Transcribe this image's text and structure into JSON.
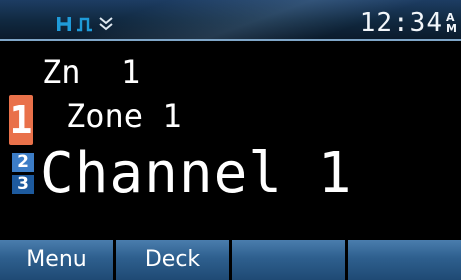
{
  "status_bar": {
    "icons": [
      "high-power-icon",
      "pulse-icon",
      "chevron-double-down-icon"
    ],
    "power_level": "H",
    "time": "12:34",
    "ampm": [
      "A",
      "M"
    ],
    "colors": {
      "icon_accent": "#1f9bd9"
    }
  },
  "display": {
    "zone_abbrev_label": "Zn",
    "zone_abbrev_number": "1",
    "zone_badge": "1",
    "zone_name": "Zone 1",
    "slot_indicator": [
      "2",
      "3"
    ],
    "channel_name": "Channel 1",
    "colors": {
      "zone_badge": "#e9714a",
      "slot_2": "#3c7dc6",
      "slot_3": "#1d5a9e"
    }
  },
  "softkeys": [
    "Menu",
    "Deck",
    "",
    ""
  ]
}
